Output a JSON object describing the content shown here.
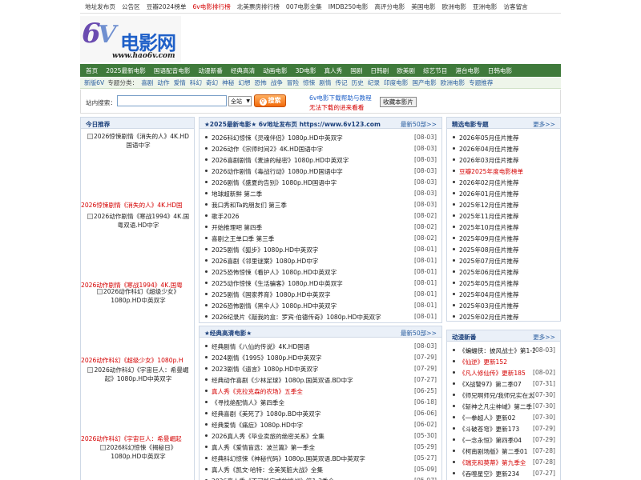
{
  "topnav": [
    {
      "label": "地址发布页",
      "red": false
    },
    {
      "label": "公告区",
      "red": false
    },
    {
      "label": "豆瓣2024榜单",
      "red": false
    },
    {
      "label": "6v电影排行榜",
      "red": true
    },
    {
      "label": "北美票房排行榜",
      "red": false
    },
    {
      "label": "007电影全集",
      "red": false
    },
    {
      "label": "IMDB250电影",
      "red": false
    },
    {
      "label": "高评分电影",
      "red": false
    },
    {
      "label": "美国电影",
      "red": false
    },
    {
      "label": "欧洲电影",
      "red": false
    },
    {
      "label": "亚洲电影",
      "red": false
    },
    {
      "label": "访客留言",
      "red": false
    }
  ],
  "logo": {
    "six": "6",
    "v": "V",
    "cn": "电影网",
    "url": "www.hao6v.com"
  },
  "mainnav": [
    "首页",
    "2025最新电影",
    "国语配音电影",
    "动漫新番",
    "经典高清",
    "动画电影",
    "3D电影",
    "真人秀",
    "国剧",
    "日韩剧",
    "欧美剧",
    "综艺节目",
    "港台电影",
    "日韩电影"
  ],
  "subnav": {
    "first": "新版6V",
    "label": "专题分类：",
    "items": [
      "喜剧",
      "动作",
      "爱情",
      "科幻",
      "奇幻",
      "神秘",
      "幻想",
      "恐怖",
      "战争",
      "冒险",
      "惊悚",
      "剧情",
      "传记",
      "历史",
      "纪录",
      "印度电影",
      "国产电影",
      "欧洲电影",
      "专题推荐"
    ]
  },
  "search": {
    "label": "站内搜索：",
    "value": "",
    "select": "全站",
    "button": "搜索",
    "help1": "6v电影下载帮助与教程",
    "help2": "无法下载的进来看看",
    "fav": "收藏本影片"
  },
  "today": {
    "title": "今日推荐",
    "items": [
      {
        "img": "2026惊悚剧情《消失的人》4K.HD国语中字",
        "cap": "2026惊悚剧情《消失的人》4K.HD国"
      },
      {
        "img": "2026动作剧情《寒战1994》4K.国粤双语.HD中字",
        "cap": "2026动作剧情《寒战1994》4K.国粤"
      },
      {
        "img": "2026动作科幻《超级少女》1080p.HD中英双字",
        "cap": "2026动作科幻《超级少女》1080p.H"
      },
      {
        "img": "2026动作科幻《宇宙巨人：希曼崛起》1080p.HD中英双字",
        "cap": "2026动作科幻《宇宙巨人：希曼崛起"
      },
      {
        "img": "2026科幻惊悚《揭秘日》1080p.HD中英双字",
        "cap": ""
      }
    ]
  },
  "latest": {
    "title": "★2025最新电影★ 6v地址发布页 https://www.6v123.com",
    "more": "最新50部>>",
    "rows": [
      {
        "t": "2026科幻惊悚《灵魂伴侣》1080p.HD中英双字",
        "d": "[08-03]",
        "red": false
      },
      {
        "t": "2026动作《宗师时间2》4K.HD国语中字",
        "d": "[08-03]",
        "red": false
      },
      {
        "t": "2026喜剧剧情《麦迪的秘密》1080p.HD中英双字",
        "d": "[08-03]",
        "red": false
      },
      {
        "t": "2026动作剧情《毒战行动》1080p.HD国语中字",
        "d": "[08-03]",
        "red": false
      },
      {
        "t": "2026剧情《盛夏的告别》1080p.HD国语中字",
        "d": "[08-03]",
        "red": false
      },
      {
        "t": "地球超新鲜 第二季",
        "d": "[08-03]",
        "red": false
      },
      {
        "t": "我口秀和Ta的朋友们 第三季",
        "d": "[08-03]",
        "red": false
      },
      {
        "t": "歌手2026",
        "d": "[08-02]",
        "red": false
      },
      {
        "t": "开始推理吧 第四季",
        "d": "[08-02]",
        "red": false
      },
      {
        "t": "喜剧之王单口季 第三季",
        "d": "[08-02]",
        "red": false
      },
      {
        "t": "2025剧情《狐步》1080p.HD中英双字",
        "d": "[08-01]",
        "red": false
      },
      {
        "t": "2026喜剧《邻里谜案》1080p.HD中字",
        "d": "[08-01]",
        "red": false
      },
      {
        "t": "2025恐怖惊悚《看护人》1080p.HD中英双字",
        "d": "[08-01]",
        "red": false
      },
      {
        "t": "2025动作惊悚《生活骗客》1080p.HD中英双字",
        "d": "[08-01]",
        "red": false
      },
      {
        "t": "2025剧情《国家养育》1080p.HD中英双字",
        "d": "[08-01]",
        "red": false
      },
      {
        "t": "2026恐怖剧情《黑伞人》1080p.HD中英双字",
        "d": "[08-01]",
        "red": false
      },
      {
        "t": "2026纪录片《敲我的盒：罗宾·伯德传奇》1080p.HD中英双字",
        "d": "[08-01]",
        "red": false
      }
    ]
  },
  "classic": {
    "title": "★经典高清电影★",
    "more": "最新50部>>",
    "rows": [
      {
        "t": "经典剧情《八仙的传说》4K.HD国语",
        "d": "[08-03]",
        "red": false
      },
      {
        "t": "2024剧情《1995》1080p.HD中英双字",
        "d": "[07-29]",
        "red": false
      },
      {
        "t": "2023剧情《遗言》1080p.HD中英双字",
        "d": "[07-29]",
        "red": false
      },
      {
        "t": "经典动作喜剧《少林足球》1080p.国英双语.BD中字",
        "d": "[07-27]",
        "red": false
      },
      {
        "t": "真人秀《克拉克森的农场》五季全",
        "d": "[06-25]",
        "red": true
      },
      {
        "t": "《寻找绝配情人》第四季全",
        "d": "[06-18]",
        "red": false
      },
      {
        "t": "经典喜剧《美死了》1080p.BD中英双字",
        "d": "[06-06]",
        "red": false
      },
      {
        "t": "经典爱情《痛症》1080p.HD中字",
        "d": "[06-02]",
        "red": false
      },
      {
        "t": "2026真人秀《毕业卖旅的绝密关系》全集",
        "d": "[05-30]",
        "red": false
      },
      {
        "t": "真人秀《爱情盲选：波兰篇》第一季全",
        "d": "[05-29]",
        "red": false
      },
      {
        "t": "经典科幻惊悚《神秘代码》1080p.国英双语.BD中英双字",
        "d": "[05-27]",
        "red": false
      },
      {
        "t": "真人秀《凯文·哈特：全美笑脏大战》全集",
        "d": "[05-09]",
        "red": false
      },
      {
        "t": "2026真人秀《不可能完成的挑战》第1-2季全",
        "d": "[05-07]",
        "red": false
      }
    ]
  },
  "topics": {
    "title": "精选电影专题",
    "more": "更多>>",
    "rows": [
      {
        "t": "2026年05月佳片推荐",
        "red": false
      },
      {
        "t": "2026年04月佳片推荐",
        "red": false
      },
      {
        "t": "2026年03月佳片推荐",
        "red": false
      },
      {
        "t": "豆瓣2025年度电影榜单",
        "red": true
      },
      {
        "t": "2026年02月佳片推荐",
        "red": false
      },
      {
        "t": "2026年01月佳片推荐",
        "red": false
      },
      {
        "t": "2025年12月佳片推荐",
        "red": false
      },
      {
        "t": "2025年11月佳片推荐",
        "red": false
      },
      {
        "t": "2025年10月佳片推荐",
        "red": false
      },
      {
        "t": "2025年09月佳片推荐",
        "red": false
      },
      {
        "t": "2025年08月佳片推荐",
        "red": false
      },
      {
        "t": "2025年07月佳片推荐",
        "red": false
      },
      {
        "t": "2025年06月佳片推荐",
        "red": false
      },
      {
        "t": "2025年05月佳片推荐",
        "red": false
      },
      {
        "t": "2025年04月佳片推荐",
        "red": false
      },
      {
        "t": "2025年03月佳片推荐",
        "red": false
      },
      {
        "t": "2025年02月佳片推荐",
        "red": false
      }
    ]
  },
  "anime": {
    "title": "动漫新番",
    "more": "更多>>",
    "rows": [
      {
        "t": "《蝙蝠侠：披风战士》第1-2季",
        "d": "[08-03]",
        "red": false
      },
      {
        "t": "《仙逆》更新152",
        "d": "",
        "red": true
      },
      {
        "t": "《凡人修仙传》更新185",
        "d": "[08-02]",
        "red": true
      },
      {
        "t": "《X战警97》第二季07",
        "d": "[07-31]",
        "red": false
      },
      {
        "t": "《师兄啊师兄/我师兄实在太",
        "d": "[07-30]",
        "red": false
      },
      {
        "t": "《斩神之凡尘神域》第二季",
        "d": "[07-30]",
        "red": false
      },
      {
        "t": "《一拳超人》更新02",
        "d": "[07-30]",
        "red": false
      },
      {
        "t": "《斗破苍穹》更新173",
        "d": "[07-29]",
        "red": false
      },
      {
        "t": "《一念永恒》第四季04",
        "d": "[07-29]",
        "red": false
      },
      {
        "t": "《柯南剧场版》第二季01",
        "d": "[07-28]",
        "red": false
      },
      {
        "t": "《瑞克和莫蒂》第九季全",
        "d": "[07-28]",
        "red": true
      },
      {
        "t": "《吞噬星空》更新234",
        "d": "[07-27]",
        "red": false
      }
    ]
  }
}
